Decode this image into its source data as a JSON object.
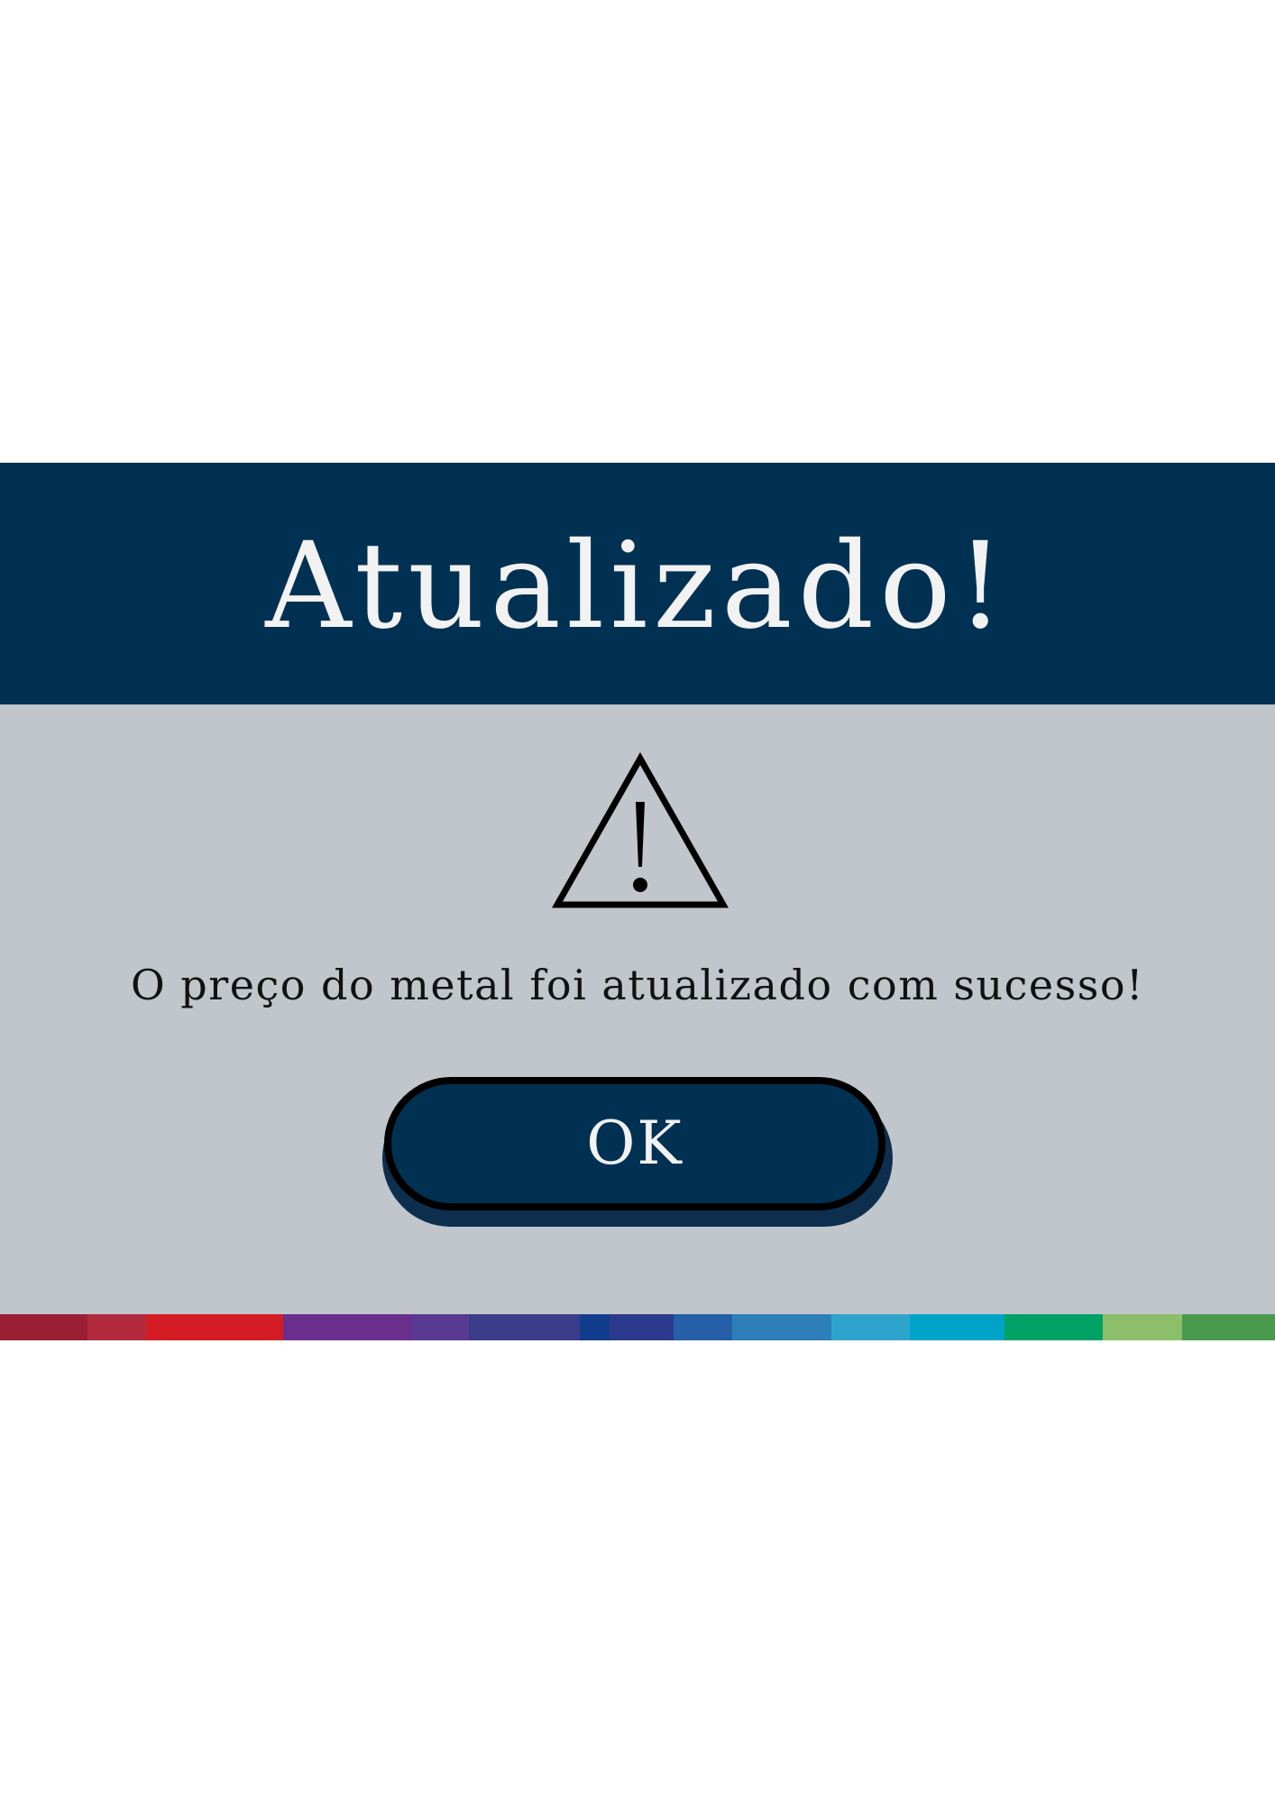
{
  "dialog": {
    "title": "Atualizado!",
    "icon": "warning-triangle-icon",
    "message": "O preço do metal foi atualizado com sucesso!",
    "ok_label": "OK"
  },
  "colors": {
    "header_bg": "#003153",
    "body_bg": "#c1c6cd",
    "button_bg": "#003153",
    "button_border": "#000000",
    "title_text": "#f2f2f2"
  },
  "color_strip": [
    "#9a1f35",
    "#b12a3e",
    "#d41c24",
    "#6a2f8c",
    "#5a3a92",
    "#3b3d8a",
    "#123d8c",
    "#2b3a8c",
    "#245fa8",
    "#2d7fba",
    "#2ea4cc",
    "#00a3c8",
    "#00a164",
    "#8dbe6a",
    "#4a9a4e"
  ]
}
